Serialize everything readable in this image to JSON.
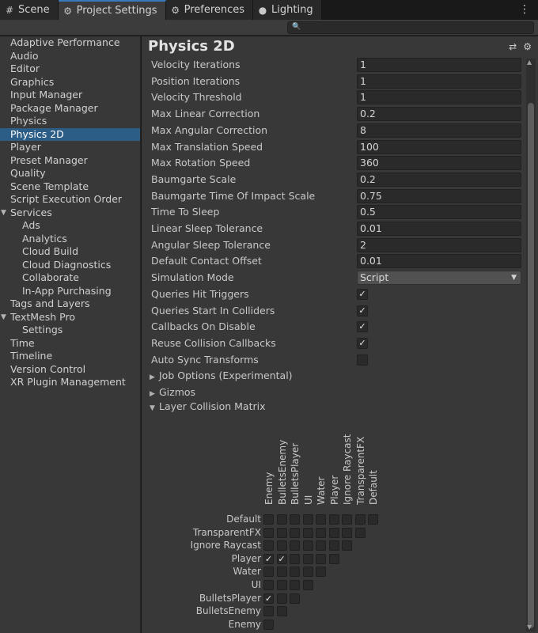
{
  "tabs": [
    {
      "label": "Scene",
      "icon": "grid-icon",
      "active": false
    },
    {
      "label": "Project Settings",
      "icon": "gear-icon",
      "active": true
    },
    {
      "label": "Preferences",
      "icon": "gear-icon",
      "active": false
    },
    {
      "label": "Lighting",
      "icon": "lightbulb-icon",
      "active": false
    }
  ],
  "search": {
    "placeholder": "",
    "value": ""
  },
  "sidebar": {
    "items": [
      {
        "label": "Adaptive Performance",
        "level": 0
      },
      {
        "label": "Audio",
        "level": 0
      },
      {
        "label": "Editor",
        "level": 0
      },
      {
        "label": "Graphics",
        "level": 0
      },
      {
        "label": "Input Manager",
        "level": 0
      },
      {
        "label": "Package Manager",
        "level": 0
      },
      {
        "label": "Physics",
        "level": 0
      },
      {
        "label": "Physics 2D",
        "level": 0,
        "selected": true
      },
      {
        "label": "Player",
        "level": 0
      },
      {
        "label": "Preset Manager",
        "level": 0
      },
      {
        "label": "Quality",
        "level": 0
      },
      {
        "label": "Scene Template",
        "level": 0
      },
      {
        "label": "Script Execution Order",
        "level": 0
      },
      {
        "label": "Services",
        "level": 0,
        "expanded": true
      },
      {
        "label": "Ads",
        "level": 1
      },
      {
        "label": "Analytics",
        "level": 1
      },
      {
        "label": "Cloud Build",
        "level": 1
      },
      {
        "label": "Cloud Diagnostics",
        "level": 1
      },
      {
        "label": "Collaborate",
        "level": 1
      },
      {
        "label": "In-App Purchasing",
        "level": 1
      },
      {
        "label": "Tags and Layers",
        "level": 0
      },
      {
        "label": "TextMesh Pro",
        "level": 0,
        "expanded": true
      },
      {
        "label": "Settings",
        "level": 1
      },
      {
        "label": "Time",
        "level": 0
      },
      {
        "label": "Timeline",
        "level": 0
      },
      {
        "label": "Version Control",
        "level": 0
      },
      {
        "label": "XR Plugin Management",
        "level": 0
      }
    ]
  },
  "main": {
    "title": "Physics 2D",
    "properties": [
      {
        "label": "Velocity Iterations",
        "type": "number",
        "value": "1"
      },
      {
        "label": "Position Iterations",
        "type": "number",
        "value": "1"
      },
      {
        "label": "Velocity Threshold",
        "type": "number",
        "value": "1"
      },
      {
        "label": "Max Linear Correction",
        "type": "number",
        "value": "0.2"
      },
      {
        "label": "Max Angular Correction",
        "type": "number",
        "value": "8"
      },
      {
        "label": "Max Translation Speed",
        "type": "number",
        "value": "100"
      },
      {
        "label": "Max Rotation Speed",
        "type": "number",
        "value": "360"
      },
      {
        "label": "Baumgarte Scale",
        "type": "number",
        "value": "0.2"
      },
      {
        "label": "Baumgarte Time Of Impact Scale",
        "type": "number",
        "value": "0.75"
      },
      {
        "label": "Time To Sleep",
        "type": "number",
        "value": "0.5"
      },
      {
        "label": "Linear Sleep Tolerance",
        "type": "number",
        "value": "0.01"
      },
      {
        "label": "Angular Sleep Tolerance",
        "type": "number",
        "value": "2"
      },
      {
        "label": "Default Contact Offset",
        "type": "number",
        "value": "0.01"
      },
      {
        "label": "Simulation Mode",
        "type": "dropdown",
        "value": "Script"
      },
      {
        "label": "Queries Hit Triggers",
        "type": "checkbox",
        "checked": true
      },
      {
        "label": "Queries Start In Colliders",
        "type": "checkbox",
        "checked": true
      },
      {
        "label": "Callbacks On Disable",
        "type": "checkbox",
        "checked": true
      },
      {
        "label": "Reuse Collision Callbacks",
        "type": "checkbox",
        "checked": true
      },
      {
        "label": "Auto Sync Transforms",
        "type": "checkbox",
        "checked": false
      }
    ],
    "foldouts": [
      {
        "label": "Job Options (Experimental)",
        "expanded": false
      },
      {
        "label": "Gizmos",
        "expanded": false
      },
      {
        "label": "Layer Collision Matrix",
        "expanded": true
      }
    ]
  },
  "matrix": {
    "layers": [
      "Default",
      "TransparentFX",
      "Ignore Raycast",
      "Player",
      "Water",
      "UI",
      "BulletsPlayer",
      "BulletsEnemy",
      "Enemy"
    ],
    "columns": [
      "Enemy",
      "BulletsEnemy",
      "BulletsPlayer",
      "UI",
      "Water",
      "Player",
      "Ignore Raycast",
      "TransparentFX",
      "Default"
    ],
    "checked": [
      {
        "row": "Player",
        "col": "Enemy"
      },
      {
        "row": "Player",
        "col": "BulletsEnemy"
      },
      {
        "row": "BulletsPlayer",
        "col": "Enemy"
      }
    ]
  }
}
